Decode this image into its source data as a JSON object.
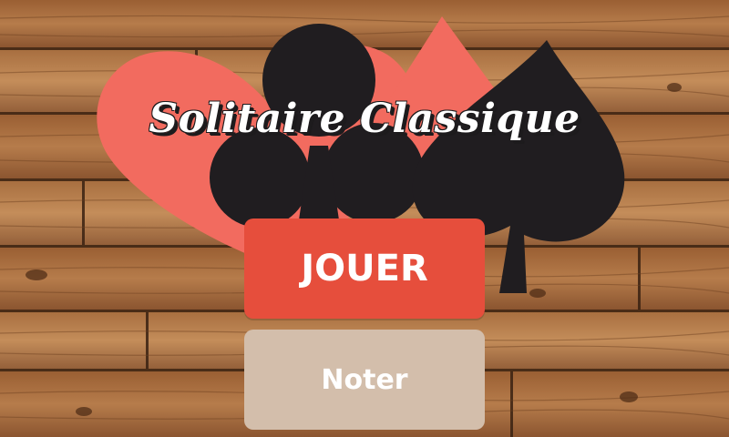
{
  "app": {
    "title": "Solitaire Classique"
  },
  "menu": {
    "play_label": "JOUER",
    "rate_label": "Noter"
  },
  "colors": {
    "play_button": "#e64e3c",
    "rate_button": "#d3beab",
    "heart_suit": "#f26b5f",
    "spade_suit": "#201d20",
    "wood": "#a0683a"
  },
  "decor": {
    "suits": [
      "heart-icon",
      "club-icon",
      "diamond-icon",
      "spade-icon"
    ]
  }
}
